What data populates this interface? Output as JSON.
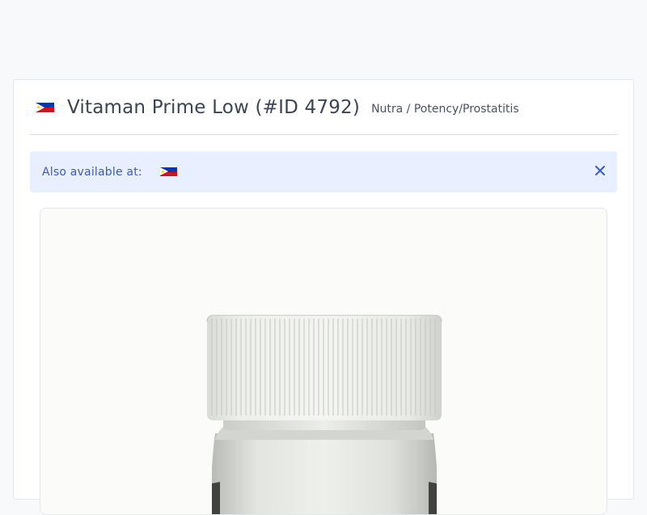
{
  "product": {
    "title": "Vitaman Prime Low (#ID 4792)",
    "category": "Nutra / Potency/Prostatitis",
    "country_flag": "philippines-flag"
  },
  "alert": {
    "text": "Also available at:",
    "flags": [
      "philippines-flag"
    ],
    "close_icon": "close-icon"
  },
  "image": {
    "subject": "product-bottle-image"
  },
  "colors": {
    "alert_bg": "#e8efff",
    "alert_text": "#3f5bb0",
    "title_text": "#3d4451"
  }
}
